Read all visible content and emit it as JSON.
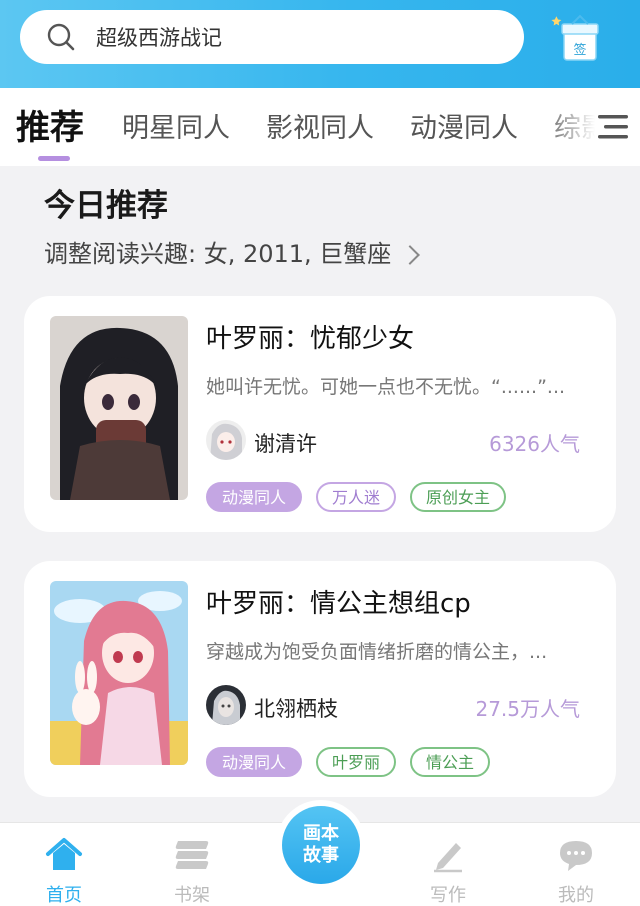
{
  "search": {
    "placeholder": "超级西游战记"
  },
  "tabs": [
    {
      "label": "推荐",
      "active": true
    },
    {
      "label": "明星同人"
    },
    {
      "label": "影视同人"
    },
    {
      "label": "动漫同人"
    },
    {
      "label": "综影"
    }
  ],
  "section": {
    "title": "今日推荐",
    "preference": "调整阅读兴趣: 女, 2011, 巨蟹座"
  },
  "books": [
    {
      "title": "叶罗丽：忧郁少女",
      "description": "她叫许无忧。可她一点也不无忧。“......”...",
      "author": "谢清许",
      "popularity": "6326人气",
      "tags": [
        "动漫同人",
        "万人迷",
        "原创女主"
      ]
    },
    {
      "title": "叶罗丽：情公主想组cp",
      "description": "穿越成为饱受负面情绪折磨的情公主，...",
      "author": "北翎栖枝",
      "popularity": "27.5万人气",
      "tags": [
        "动漫同人",
        "叶罗丽",
        "情公主"
      ]
    }
  ],
  "gift": {
    "label": "签"
  },
  "bottom_nav": {
    "home": "首页",
    "shelf": "书架",
    "center": "画本故事",
    "write": "写作",
    "mine": "我的"
  },
  "colors": {
    "accent": "#2fb0ee",
    "tab_indicator": "#b58fe0",
    "tag_purple": "#c4a6e3",
    "tag_green": "#4c9e55"
  }
}
